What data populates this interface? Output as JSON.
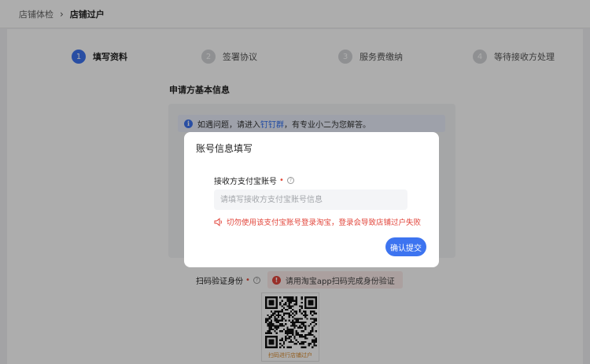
{
  "breadcrumb": {
    "parent": "店铺体检",
    "separator": "›",
    "current": "店铺过户"
  },
  "steps": [
    {
      "num": "1",
      "label": "填写资料",
      "active": true
    },
    {
      "num": "2",
      "label": "签署协议",
      "active": false
    },
    {
      "num": "3",
      "label": "服务费缴纳",
      "active": false
    },
    {
      "num": "4",
      "label": "等待接收方处理",
      "active": false
    }
  ],
  "section": {
    "title": "申请方基本信息"
  },
  "notice": {
    "icon": "info-icon",
    "prefix": "如遇问题，请进入",
    "link": "钉钉群",
    "suffix": "，有专业小二为您解答。"
  },
  "scan": {
    "label": "扫码验证身份",
    "required": "•",
    "help": "?",
    "warning_icon": "error-icon",
    "warning": "请用淘宝app扫码完成身份验证",
    "qr_caption": "扫码进行店铺过户"
  },
  "modal": {
    "title": "账号信息填写",
    "field_label": "接收方支付宝账号",
    "required": "•",
    "help": "?",
    "input_value": "",
    "input_placeholder": "请填写接收方支付宝账号信息",
    "warning_icon": "speaker-icon",
    "warning": "切勿使用该支付宝账号登录淘宝，登录会导致店铺过户失败",
    "confirm_label": "确认提交"
  },
  "colors": {
    "primary": "#3d74f0",
    "danger": "#e2453b",
    "overlay": "rgba(0,0,0,0.32)"
  }
}
